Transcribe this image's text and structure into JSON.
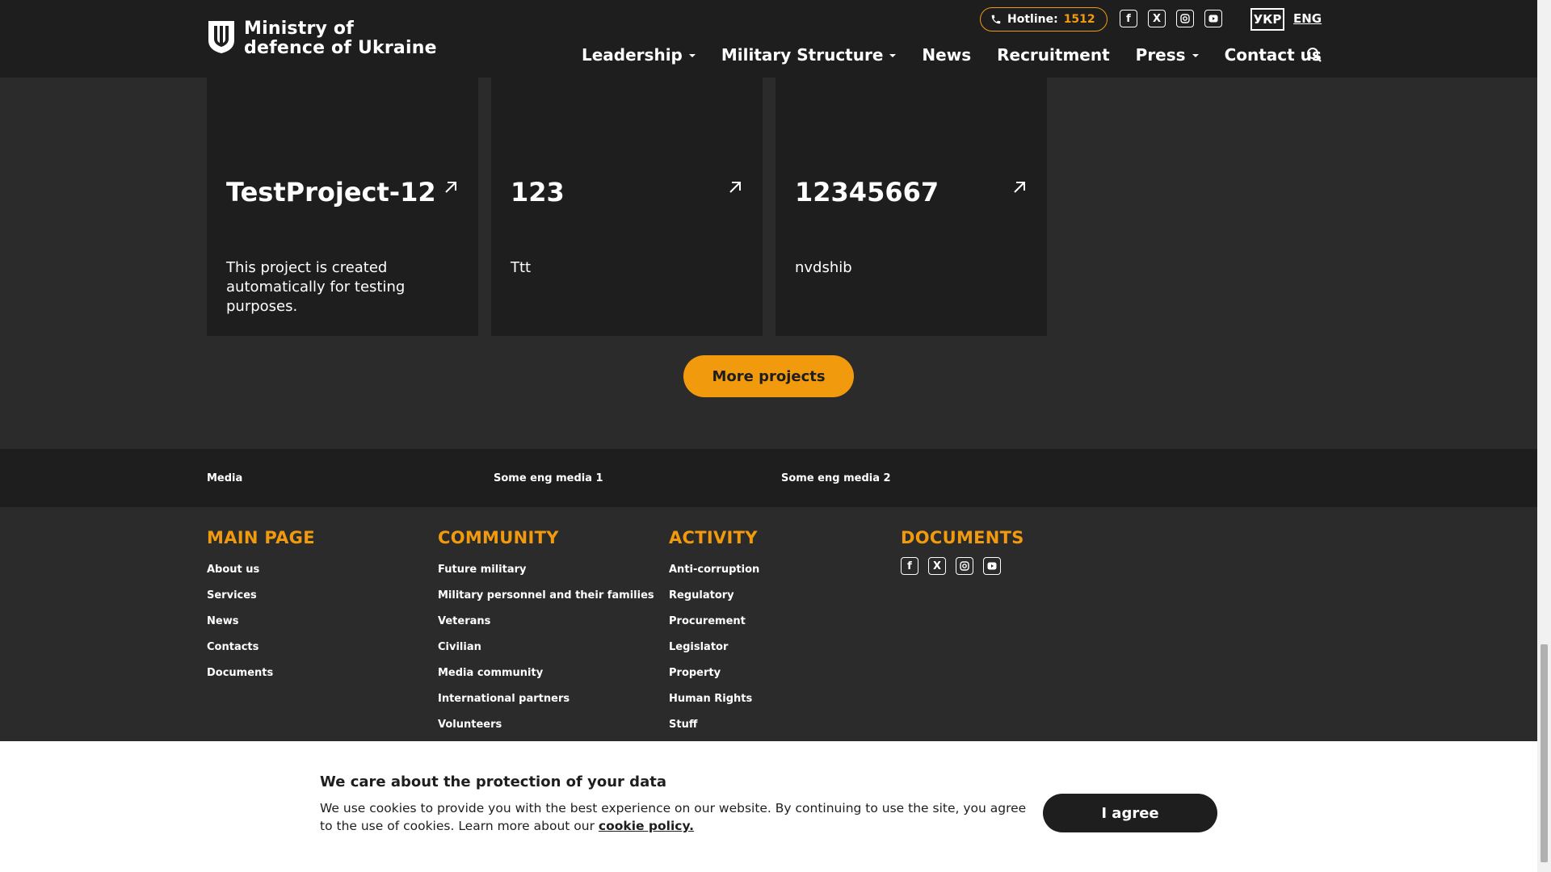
{
  "header": {
    "logo_line1": "Ministry of",
    "logo_line2": "defence of Ukraine",
    "hotline_label": "Hotline:",
    "hotline_number": "1512",
    "lang_ukr": "УКР",
    "lang_eng": "ENG",
    "nav": [
      {
        "label": "Leadership"
      },
      {
        "label": "Military Structure"
      },
      {
        "label": "News"
      },
      {
        "label": "Recruitment"
      },
      {
        "label": "Press"
      },
      {
        "label": "Contact us"
      }
    ]
  },
  "projects": [
    {
      "title": "TestProject-12",
      "desc": "This project is created automatically for testing purposes."
    },
    {
      "title": "123",
      "desc": "Ttt"
    },
    {
      "title": "12345667",
      "desc": "nvdshib"
    }
  ],
  "more_projects_label": "More projects",
  "media": [
    "Media",
    "Some eng media 1",
    "Some eng media 2"
  ],
  "footer": {
    "col1": {
      "heading": "MAIN PAGE",
      "links": [
        "About us",
        "Services",
        "News",
        "Contacts",
        "Documents"
      ]
    },
    "col2": {
      "heading": "COMMUNITY",
      "links": [
        "Future military",
        "Military personnel and their families",
        "Veterans",
        "Civilian",
        "Media community",
        "International partners",
        "Volunteers"
      ]
    },
    "col3": {
      "heading": "ACTIVITY",
      "links": [
        "Anti-corruption",
        "Regulatory",
        "Procurement",
        "Legislator",
        "Property",
        "Human Rights",
        "Stuff"
      ]
    },
    "col4": {
      "heading": "DOCUMENTS"
    }
  },
  "cookie": {
    "title": "We care about the protection of your data",
    "text": "We use cookies to provide you with the best experience on our website. By continuing to use the site, you agree to the use of cookies. Learn more about our ",
    "link": "cookie policy.",
    "button": "I agree"
  },
  "colors": {
    "accent": "#f29a0e",
    "dark": "#1e1e1e",
    "bg": "#2b2b2b"
  },
  "icons": [
    "ukraine-trident-icon",
    "phone-icon",
    "facebook-icon",
    "x-twitter-icon",
    "instagram-icon",
    "youtube-icon",
    "search-icon",
    "arrow-up-right-icon"
  ]
}
